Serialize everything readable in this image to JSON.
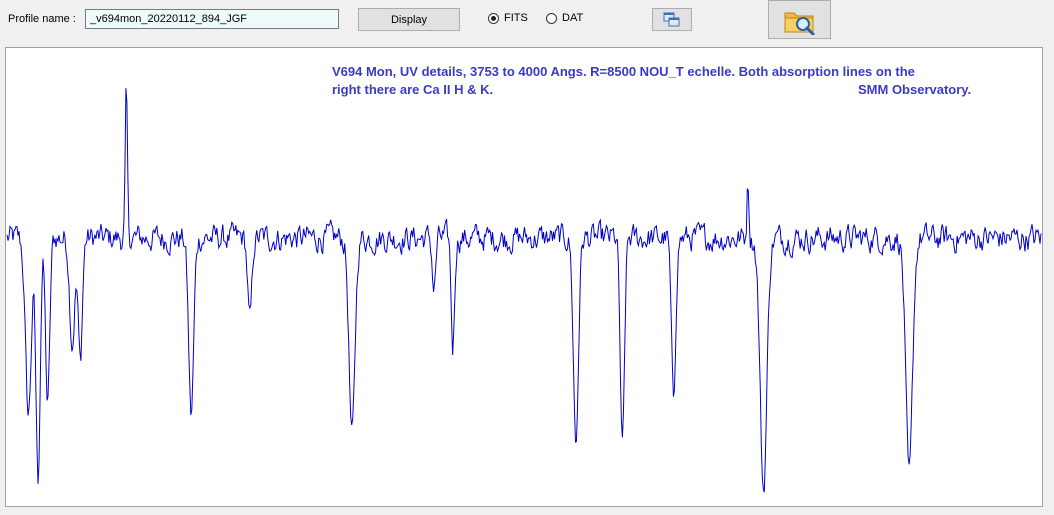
{
  "toolbar": {
    "profile_label": "Profile name :",
    "profile_value": "_v694mon_20220112_894_JGF",
    "display_label": "Display",
    "format_options": [
      {
        "label": "FITS",
        "selected": true
      },
      {
        "label": "DAT",
        "selected": false
      }
    ],
    "copy_icon": "copy-windows-icon",
    "open_icon": "folder-magnifier-icon"
  },
  "plot": {
    "annotation_line1": "V694 Mon, UV details, 3753 to 4000 Angs. R=8500 NOU_T echelle. Both absorption lines on the",
    "annotation_line2": "right there are Ca II H & K.",
    "annotation_line3": "SMM Observatory.",
    "line_color": "#0000cc",
    "annotation_color": "#3a3ac8"
  },
  "chart_data": {
    "type": "line",
    "title": "",
    "xlabel": "",
    "ylabel": "",
    "x_range": [
      3753,
      4000
    ],
    "x_unit": "Angs.",
    "continuum_level": 1.0,
    "noise_amplitude": 0.05,
    "absorption_lines": [
      {
        "x": 3758.1,
        "depth": 0.55,
        "width": 0.7
      },
      {
        "x": 3760.4,
        "depth": 0.75,
        "width": 0.5
      },
      {
        "x": 3762.7,
        "depth": 0.52,
        "width": 0.5
      },
      {
        "x": 3768.6,
        "depth": 0.32,
        "width": 0.6
      },
      {
        "x": 3770.5,
        "depth": 0.38,
        "width": 0.5
      },
      {
        "x": 3797.0,
        "depth": 0.55,
        "width": 0.6
      },
      {
        "x": 3811.0,
        "depth": 0.26,
        "width": 0.5
      },
      {
        "x": 3835.4,
        "depth": 0.62,
        "width": 0.7
      },
      {
        "x": 3855.0,
        "depth": 0.16,
        "width": 0.4
      },
      {
        "x": 3859.5,
        "depth": 0.34,
        "width": 0.4
      },
      {
        "x": 3888.9,
        "depth": 0.64,
        "width": 0.6
      },
      {
        "x": 3900.0,
        "depth": 0.66,
        "width": 0.5
      },
      {
        "x": 3912.2,
        "depth": 0.51,
        "width": 0.5
      },
      {
        "x": 3933.7,
        "depth": 0.78,
        "width": 0.8
      },
      {
        "x": 3968.5,
        "depth": 0.75,
        "width": 0.8
      }
    ],
    "emission_spikes": [
      {
        "x": 3781.5,
        "height": 0.45
      },
      {
        "x": 3930.0,
        "height": 0.18
      }
    ]
  }
}
